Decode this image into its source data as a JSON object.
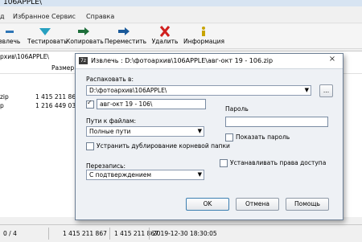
{
  "window": {
    "title": "106APPLE\\"
  },
  "menu": [
    "д",
    "Избранное",
    "Сервис",
    "Справка"
  ],
  "toolbar": {
    "extract": "звлечь",
    "test": "Тестировать",
    "copy": "Копировать",
    "move": "Переместить",
    "delete": "Удалить",
    "info": "Информация"
  },
  "path": "рхив\\106APPLE\\",
  "list": {
    "header_size": "Размер",
    "rows": [
      {
        "name": "zip",
        "size": "1 415 211 867"
      },
      {
        "name": "p",
        "size": "1 216 449 037"
      }
    ]
  },
  "dialog": {
    "title": "Извлечь : D:\\фотоархив\\106APPLE\\авг-окт 19 - 106.zip",
    "close": "×",
    "extract_to_label": "Распаковать в:",
    "extract_to_value": "D:\\фотоархив\\106APPLE\\",
    "browse": "...",
    "folder_value": "авг-окт 19 - 106\\",
    "paths_label": "Пути к файлам:",
    "paths_value": "Полные пути",
    "dedup_label": "Устранить дублирование корневой папки",
    "overwrite_label": "Перезапись:",
    "overwrite_value": "С подтверждением",
    "password_label": "Пароль",
    "show_password_label": "Показать пароль",
    "access_rights_label": "Устанавливать права доступа",
    "ok": "OK",
    "cancel": "Отмена",
    "help": "Помощь"
  },
  "status": {
    "selection": "0 / 4",
    "size1": "1 415 211 867",
    "size2": "1 415 211 867",
    "datetime": "2019-12-30 18:30:05"
  },
  "icons": {
    "extract": "minus-icon",
    "test": "check-icon",
    "copy": "arrow-right-icon",
    "move": "arrow-right-icon",
    "delete": "x-icon",
    "info": "info-icon"
  },
  "colors": {
    "accent": "#2e75b6",
    "delete": "#d0201f",
    "test": "#27a0c0",
    "copy": "#1e6f3a",
    "move": "#1b5a9a",
    "info": "#c8a400"
  }
}
